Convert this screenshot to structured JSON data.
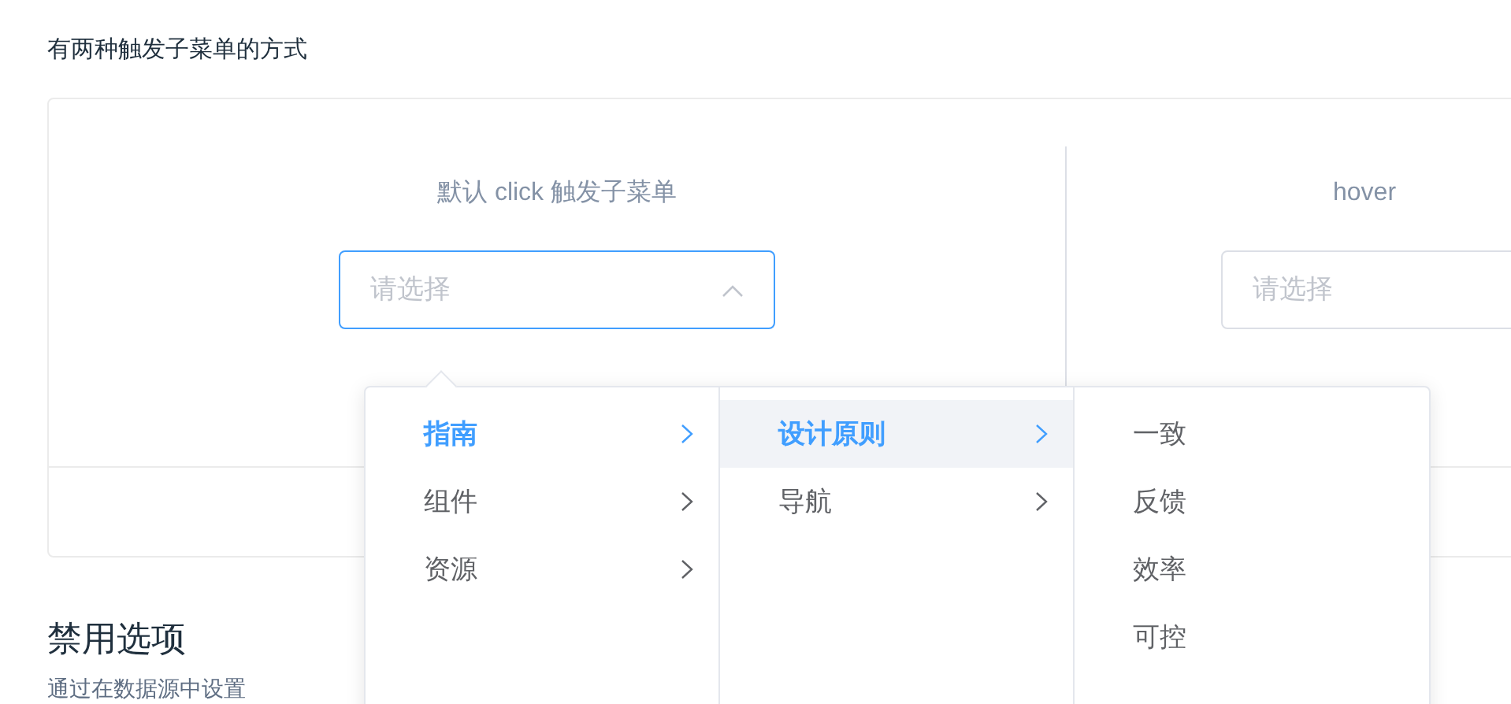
{
  "intro": "有两种触发子菜单的方式",
  "demos": [
    {
      "label": "默认 click 触发子菜单",
      "placeholder": "请选择",
      "open": true
    },
    {
      "label": "hover",
      "placeholder": "请选择",
      "open": false
    }
  ],
  "section_title": "禁用选项",
  "section_text": "通过在数据源中设置",
  "menu": [
    [
      {
        "label": "指南",
        "selected": true,
        "hover": false,
        "has_children": true
      },
      {
        "label": "组件",
        "selected": false,
        "hover": false,
        "has_children": true
      },
      {
        "label": "资源",
        "selected": false,
        "hover": false,
        "has_children": true
      }
    ],
    [
      {
        "label": "设计原则",
        "selected": true,
        "hover": true,
        "has_children": true
      },
      {
        "label": "导航",
        "selected": false,
        "hover": false,
        "has_children": true
      }
    ],
    [
      {
        "label": "一致",
        "selected": false,
        "hover": false,
        "has_children": false
      },
      {
        "label": "反馈",
        "selected": false,
        "hover": false,
        "has_children": false
      },
      {
        "label": "效率",
        "selected": false,
        "hover": false,
        "has_children": false
      },
      {
        "label": "可控",
        "selected": false,
        "hover": false,
        "has_children": false
      }
    ]
  ]
}
